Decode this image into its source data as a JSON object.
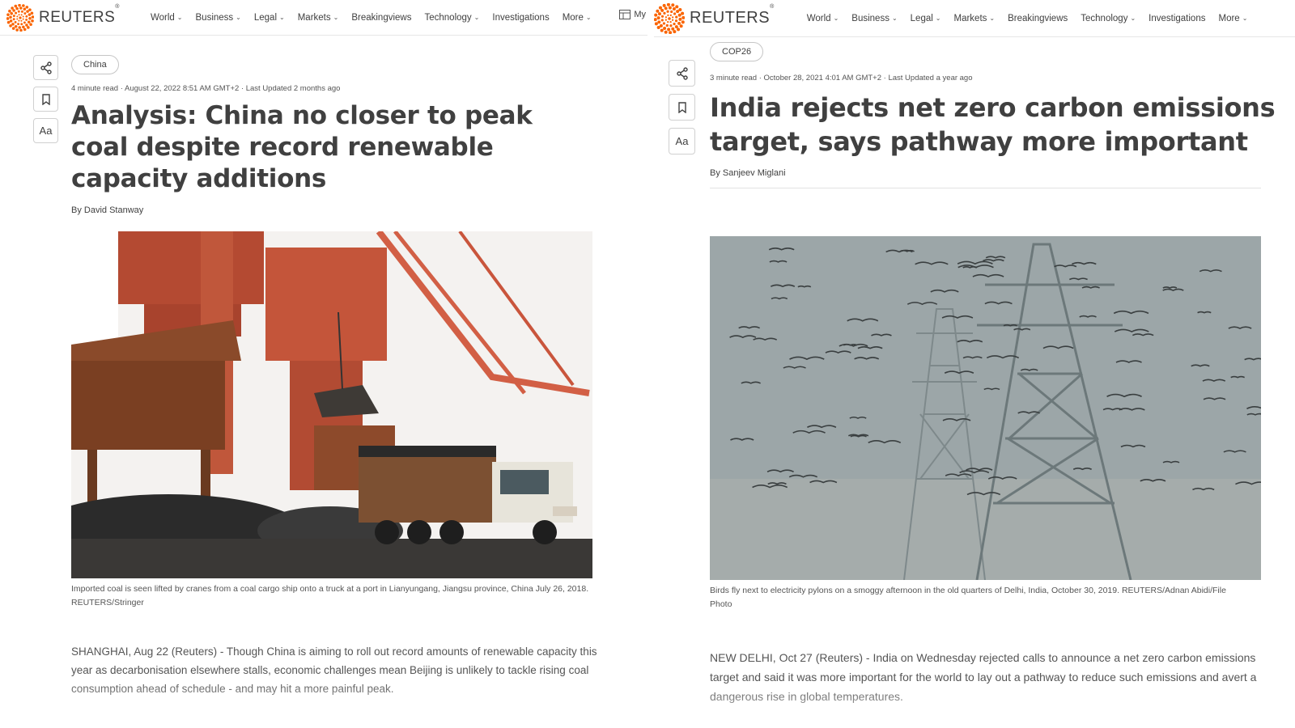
{
  "brand": {
    "name": "REUTERS",
    "registered": "®"
  },
  "left": {
    "nav": [
      "World",
      "Business",
      "Legal",
      "Markets",
      "Breakingviews",
      "Technology",
      "Investigations",
      "More"
    ],
    "nav_dropdown": [
      true,
      true,
      true,
      true,
      false,
      true,
      false,
      true
    ],
    "my_news_label": "My",
    "actions": {
      "font_label": "Aa"
    },
    "tag": "China",
    "meta": "4 minute read · August 22, 2022 8:51 AM GMT+2 · Last Updated 2 months ago",
    "headline": "Analysis: China no closer to peak coal despite record renewable capacity additions",
    "byline_prefix": "By ",
    "author": "David Stanway",
    "caption": "Imported coal is seen lifted by cranes from a coal cargo ship onto a truck at a port in Lianyungang, Jiangsu province, China July 26, 2018. REUTERS/Stringer",
    "body": "SHANGHAI, Aug 22 (Reuters) - Though China is aiming to roll out record amounts of renewable capacity this year as decarbonisation elsewhere stalls, economic challenges mean Beijing is unlikely to tackle rising coal consumption ahead of schedule - and may hit a more painful peak."
  },
  "right": {
    "nav": [
      "World",
      "Business",
      "Legal",
      "Markets",
      "Breakingviews",
      "Technology",
      "Investigations",
      "More"
    ],
    "actions": {
      "font_label": "Aa"
    },
    "tag": "COP26",
    "meta": "3 minute read · October 28, 2021 4:01 AM GMT+2 · Last Updated a year ago",
    "headline": "India rejects net zero carbon emissions target, says pathway more important",
    "byline_prefix": "By ",
    "author": "Sanjeev Miglani",
    "caption": "Birds fly next to electricity pylons on a smoggy afternoon in the old quarters of Delhi, India, October 30, 2019. REUTERS/Adnan Abidi/File Photo",
    "body": "NEW DELHI, Oct 27 (Reuters) - India on Wednesday rejected calls to announce a net zero carbon emissions target and said it was more important for the world to lay out a pathway to reduce such emissions and avert a dangerous rise in global temperatures."
  },
  "colors": {
    "accent": "#fa6400",
    "text": "#404040",
    "muted": "#555555"
  },
  "icons": {
    "share": "share-icon",
    "bookmark": "bookmark-icon",
    "font": "font-size-icon",
    "logo": "reuters-logo-icon",
    "chevron": "chevron-down-icon",
    "my_news": "layout-icon"
  }
}
